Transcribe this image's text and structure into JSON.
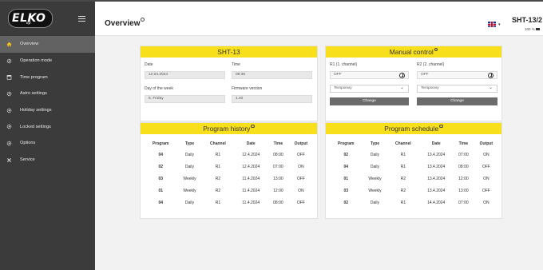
{
  "brand": {
    "logo_text": "ELKO",
    "logo_sub": "ep"
  },
  "sidebar": {
    "items": [
      {
        "label": "Overview",
        "icon": "home-icon",
        "active": true
      },
      {
        "label": "Operation mode",
        "icon": "gear-icon"
      },
      {
        "label": "Time program",
        "icon": "calendar-icon"
      },
      {
        "label": "Astro settings",
        "icon": "gear-icon"
      },
      {
        "label": "Holiday settings",
        "icon": "gear-icon"
      },
      {
        "label": "Locked settings",
        "icon": "gear-icon"
      },
      {
        "label": "Options",
        "icon": "gear-icon"
      },
      {
        "label": "Service",
        "icon": "tools-icon"
      }
    ]
  },
  "header": {
    "title": "Overview",
    "device_name": "SHT-13/2",
    "battery": "100 %",
    "language_flag": "uk-flag-icon"
  },
  "device_card": {
    "title": "SHT-13",
    "date_label": "Date",
    "date_value": "12.04.2024",
    "time_label": "Time",
    "time_value": "09:36",
    "dow_label": "Day of the week",
    "dow_value": "5. Friday",
    "fw_label": "Firmware version",
    "fw_value": "1.40"
  },
  "manual_control": {
    "title": "Manual control",
    "r1_label": "R1 (1. channel)",
    "r1_state": "OFF",
    "r1_mode": "Temporary",
    "r1_button": "Change",
    "r2_label": "R2 (2. channel)",
    "r2_state": "OFF",
    "r2_mode": "Temporary",
    "r2_button": "Change"
  },
  "program_history": {
    "title": "Program history",
    "columns": [
      "Program",
      "Type",
      "Channel",
      "Date",
      "Time",
      "Output"
    ],
    "rows": [
      [
        "04",
        "Daily",
        "R1",
        "12.4.2024",
        "08:00",
        "OFF"
      ],
      [
        "02",
        "Daily",
        "R1",
        "12.4.2024",
        "07:00",
        "ON"
      ],
      [
        "03",
        "Weekly",
        "R2",
        "11.4.2024",
        "13:00",
        "OFF"
      ],
      [
        "01",
        "Weekly",
        "R2",
        "11.4.2024",
        "12:00",
        "ON"
      ],
      [
        "04",
        "Daily",
        "R1",
        "11.4.2024",
        "08:00",
        "OFF"
      ]
    ]
  },
  "program_schedule": {
    "title": "Program schedule",
    "columns": [
      "Program",
      "Type",
      "Channel",
      "Date",
      "Time",
      "Output"
    ],
    "rows": [
      [
        "02",
        "Daily",
        "R1",
        "13.4.2024",
        "07:00",
        "ON"
      ],
      [
        "04",
        "Daily",
        "R1",
        "13.4.2024",
        "08:00",
        "OFF"
      ],
      [
        "01",
        "Weekly",
        "R2",
        "13.4.2024",
        "12:00",
        "ON"
      ],
      [
        "03",
        "Weekly",
        "R2",
        "13.4.2024",
        "13:00",
        "OFF"
      ],
      [
        "02",
        "Daily",
        "R1",
        "14.4.2024",
        "07:00",
        "ON"
      ]
    ]
  },
  "colors": {
    "accent": "#f8df1c",
    "sidebar": "#3b3b3b",
    "active_item": "#626262",
    "button": "#6b6b6b"
  }
}
